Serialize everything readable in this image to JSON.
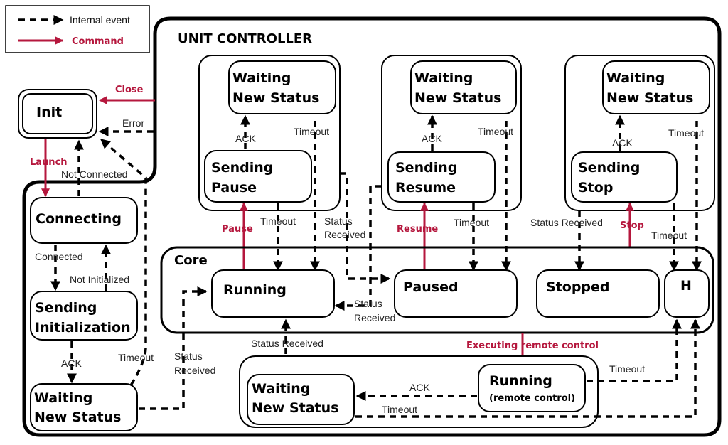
{
  "colors": {
    "command": "#b5173d",
    "event": "#000000",
    "background": "#ffffff"
  },
  "legend": {
    "internal_event": "Internal event",
    "command": "Command"
  },
  "containers": {
    "unit_controller": "UNIT CONTROLLER",
    "core": "Core"
  },
  "states": {
    "init": "Init",
    "connecting": "Connecting",
    "sending_init": [
      "Sending",
      "Initialization"
    ],
    "waiting_left": [
      "Waiting",
      "New Status"
    ],
    "waiting_pause": [
      "Waiting",
      "New Status"
    ],
    "sending_pause": [
      "Sending",
      "Pause"
    ],
    "waiting_resume": [
      "Waiting",
      "New Status"
    ],
    "sending_resume": [
      "Sending",
      "Resume"
    ],
    "waiting_stop": [
      "Waiting",
      "New Status"
    ],
    "sending_stop": [
      "Sending",
      "Stop"
    ],
    "running": "Running",
    "paused": "Paused",
    "stopped": "Stopped",
    "history": "H",
    "waiting_bottom": [
      "Waiting",
      "New Status"
    ],
    "running_remote": [
      "Running",
      "(remote control)"
    ]
  },
  "commands": {
    "close": "Close",
    "launch": "Launch",
    "pause": "Pause",
    "resume": "Resume",
    "stop": "Stop",
    "exec_remote": "Executing remote control"
  },
  "events": {
    "error": "Error",
    "not_connected": "Not Connected",
    "connected": "Connected",
    "not_initialized": "Not Initialized",
    "ack_left": "ACK",
    "timeout_left": "Timeout",
    "status_received_left": [
      "Status",
      "Received"
    ],
    "ack_pause": "ACK",
    "timeout_pause_top": "Timeout",
    "timeout_pause_bottom": "Timeout",
    "status_received_pause": [
      "Status",
      "Received"
    ],
    "ack_resume": "ACK",
    "timeout_resume_top": "Timeout",
    "timeout_resume_bottom": "Timeout",
    "ack_stop": "ACK",
    "timeout_stop_top": "Timeout",
    "status_received_stop": "Status Received",
    "timeout_stop_bottom": "Timeout",
    "status_received_running": [
      "Status",
      "Received"
    ],
    "status_received_bottom": "Status Received",
    "ack_bottom": "ACK",
    "timeout_bottom": "Timeout",
    "timeout_remote": "Timeout"
  }
}
